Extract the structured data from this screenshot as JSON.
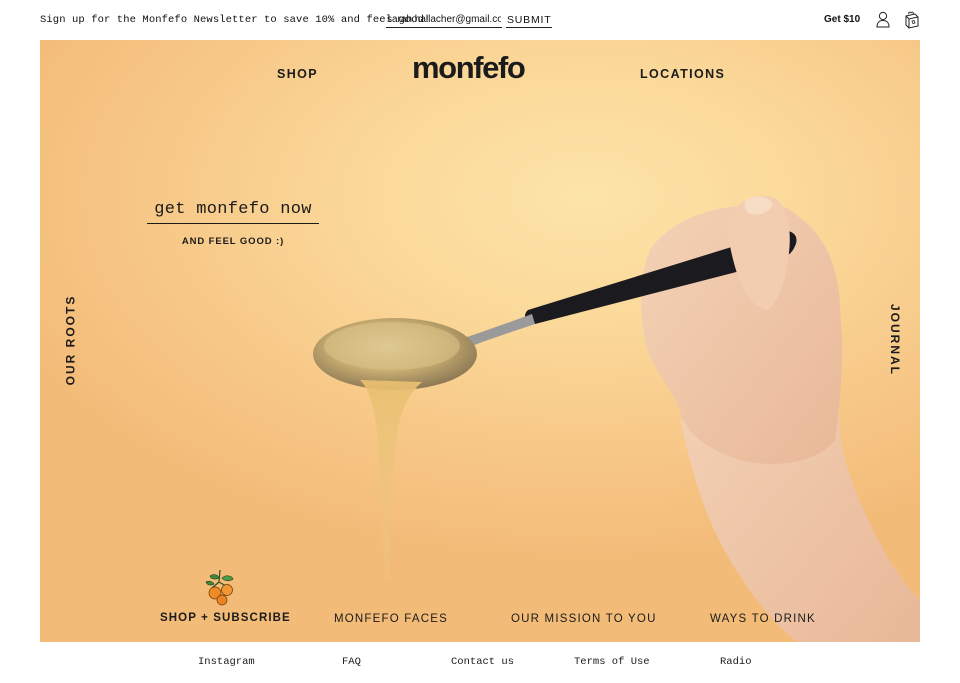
{
  "newsletter": {
    "text": "Sign up for the Monfefo Newsletter to save 10% and feel good!",
    "email_value": "sarah.hallacher@gmail.com",
    "submit_label": "SUBMIT"
  },
  "header": {
    "promo_label": "Get $10",
    "account_icon": "person-icon",
    "cart_icon": "gift-box-icon"
  },
  "hero": {
    "logo": "monfefo",
    "nav_left": "SHOP",
    "nav_right": "LOCATIONS",
    "cta_label": "get monfefo now",
    "cta_sub": "AND FEEL GOOD :)",
    "side_left": "OUR ROOTS",
    "side_right": "JOURNAL",
    "bottom_links": [
      "SHOP + SUBSCRIBE",
      "MONFEFO FACES",
      "OUR MISSION TO YOU",
      "WAYS TO DRINK"
    ],
    "shop_icon": "orange-branch-icon"
  },
  "footer": {
    "links": [
      "Instagram",
      "FAQ",
      "Contact us",
      "Terms of Use",
      "Radio"
    ]
  },
  "colors": {
    "hero_bg": "#fbd99a",
    "text": "#1b1b1b",
    "orange": "#f08a24",
    "leaf": "#3f8a3a"
  }
}
